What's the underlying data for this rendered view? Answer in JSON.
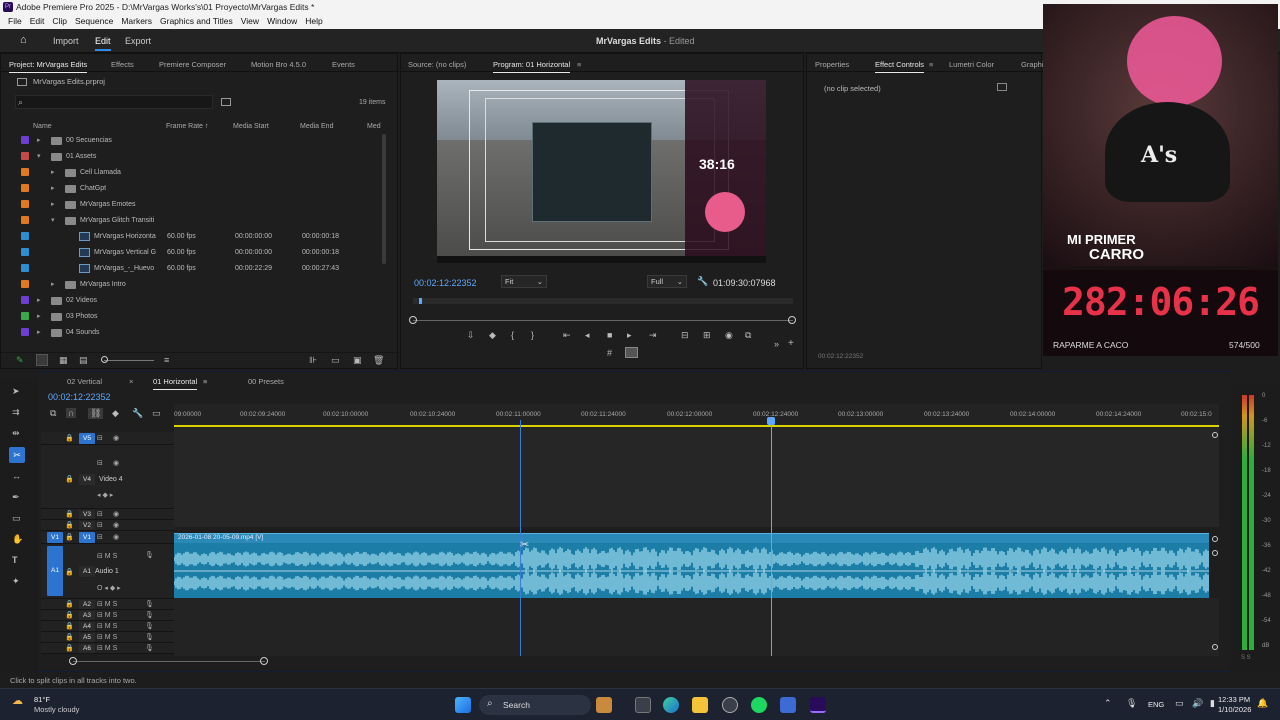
{
  "app": {
    "window_title": "Adobe Premiere Pro 2025 - D:\\MrVargas Works's\\01 Proyecto\\MrVargas Edits *",
    "menu": [
      "File",
      "Edit",
      "Clip",
      "Sequence",
      "Markers",
      "Graphics and Titles",
      "View",
      "Window",
      "Help"
    ],
    "workspace_tabs": [
      "Import",
      "Edit",
      "Export"
    ],
    "active_workspace": "Edit",
    "project_name": "MrVargas Edits",
    "project_state": "- Edited"
  },
  "project_panel": {
    "tabs": [
      "Project: MrVargas Edits",
      "Effects",
      "Premiere Composer",
      "Motion Bro 4.5.0",
      "Events"
    ],
    "file": "MrVargas Edits.prproj",
    "item_count": "19 items",
    "columns": [
      "Name",
      "Frame Rate",
      "Media Start",
      "Media End",
      "Med"
    ],
    "rows": [
      {
        "name": "00 Secuencias",
        "color": "#6b3fd1",
        "kind": "folder",
        "fps": "",
        "start": "",
        "end": "",
        "depth": 0,
        "open": false
      },
      {
        "name": "01 Assets",
        "color": "#c44a4a",
        "kind": "folder",
        "fps": "",
        "start": "",
        "end": "",
        "depth": 0,
        "open": true
      },
      {
        "name": "Cell Llamada",
        "color": "#e07a1f",
        "kind": "folder",
        "fps": "",
        "start": "",
        "end": "",
        "depth": 1,
        "open": false
      },
      {
        "name": "ChatGpt",
        "color": "#e07a1f",
        "kind": "folder",
        "fps": "",
        "start": "",
        "end": "",
        "depth": 1,
        "open": false
      },
      {
        "name": "MrVargas Emotes",
        "color": "#e07a1f",
        "kind": "folder",
        "fps": "",
        "start": "",
        "end": "",
        "depth": 1,
        "open": false
      },
      {
        "name": "MrVargas Glitch Transiti",
        "color": "#e07a1f",
        "kind": "folder",
        "fps": "",
        "start": "",
        "end": "",
        "depth": 1,
        "open": true
      },
      {
        "name": "MrVargas Horizonta",
        "color": "#2e8fcf",
        "kind": "clip",
        "fps": "60.00 fps",
        "start": "00:00:00:00",
        "end": "00:00:00:18",
        "depth": 2
      },
      {
        "name": "MrVargas Vertical G",
        "color": "#2e8fcf",
        "kind": "clip",
        "fps": "60.00 fps",
        "start": "00:00:00:00",
        "end": "00:00:00:18",
        "depth": 2
      },
      {
        "name": "MrVargas_-_Huevo",
        "color": "#2e8fcf",
        "kind": "clip",
        "fps": "60.00 fps",
        "start": "00:00:22:29",
        "end": "00:00:27:43",
        "depth": 2
      },
      {
        "name": "MrVargas Intro",
        "color": "#e07a1f",
        "kind": "folder",
        "fps": "",
        "start": "",
        "end": "",
        "depth": 1,
        "open": false
      },
      {
        "name": "02 Videos",
        "color": "#6b3fd1",
        "kind": "folder",
        "fps": "",
        "start": "",
        "end": "",
        "depth": 0,
        "open": false
      },
      {
        "name": "03 Photos",
        "color": "#3aa84a",
        "kind": "folder",
        "fps": "",
        "start": "",
        "end": "",
        "depth": 0,
        "open": false
      },
      {
        "name": "04 Sounds",
        "color": "#6b3fd1",
        "kind": "folder",
        "fps": "",
        "start": "",
        "end": "",
        "depth": 0,
        "open": false
      }
    ]
  },
  "program_panel": {
    "tabs": [
      "Source: (no clips)",
      "Program: 01 Horizontal"
    ],
    "timecode": "00:02:12:22352",
    "fit": "Fit",
    "quality": "Full",
    "duration": "01:09:30:07968",
    "overlay_timer": "38:16"
  },
  "effects_panel": {
    "tabs": [
      "Properties",
      "Effect Controls",
      "Lumetri Color",
      "Graphi"
    ],
    "message": "(no clip selected)",
    "timecode": "00:02:12:22352"
  },
  "webcam": {
    "banner_line1": "MI PRIMER",
    "banner_line2": "CARRO",
    "countdown": "282:06:26",
    "goal_label": "RAPARME A CACO",
    "goal_progress": "574/500",
    "cap_logo": "A's"
  },
  "timeline": {
    "tabs": [
      "02 Vertical",
      "01 Horizontal",
      "00 Presets"
    ],
    "active_tab": "01 Horizontal",
    "timecode": "00:02:12:22352",
    "ruler": [
      "09:00000",
      "00:02:09:24000",
      "00:02:10:00000",
      "00:02:10:24000",
      "00:02:11:00000",
      "00:02:11:24000",
      "00:02:12:00000",
      "00:02:12:24000",
      "00:02:13:00000",
      "00:02:13:24000",
      "00:02:14:00000",
      "00:02:14:24000",
      "00:02:15:0"
    ],
    "video_clip": "2026-01-08 20-05-09.mp4 [V]",
    "tracks": {
      "v5": "V5",
      "v4": "V4",
      "v4_name": "Video 4",
      "v3": "V3",
      "v2": "V2",
      "v1": "V1",
      "v1_target": "V1",
      "a1_target": "A1",
      "a1": "A1",
      "a1_name": "Audio 1",
      "a2": "A2",
      "a3": "A3",
      "a4": "A4",
      "a5": "A5",
      "a6": "A6"
    },
    "meter_scale": [
      "0",
      "-6",
      "-12",
      "-18",
      "-24",
      "-30",
      "-36",
      "-42",
      "-48",
      "-54",
      "dB"
    ],
    "meter_sub": "S S"
  },
  "status_bar": {
    "hint": "Click to split clips in all tracks into two."
  },
  "taskbar": {
    "weather_temp": "81°F",
    "weather_desc": "Mostly cloudy",
    "search": "Search",
    "lang": "ENG",
    "time": "12:33 PM",
    "date": "1/10/2026"
  }
}
